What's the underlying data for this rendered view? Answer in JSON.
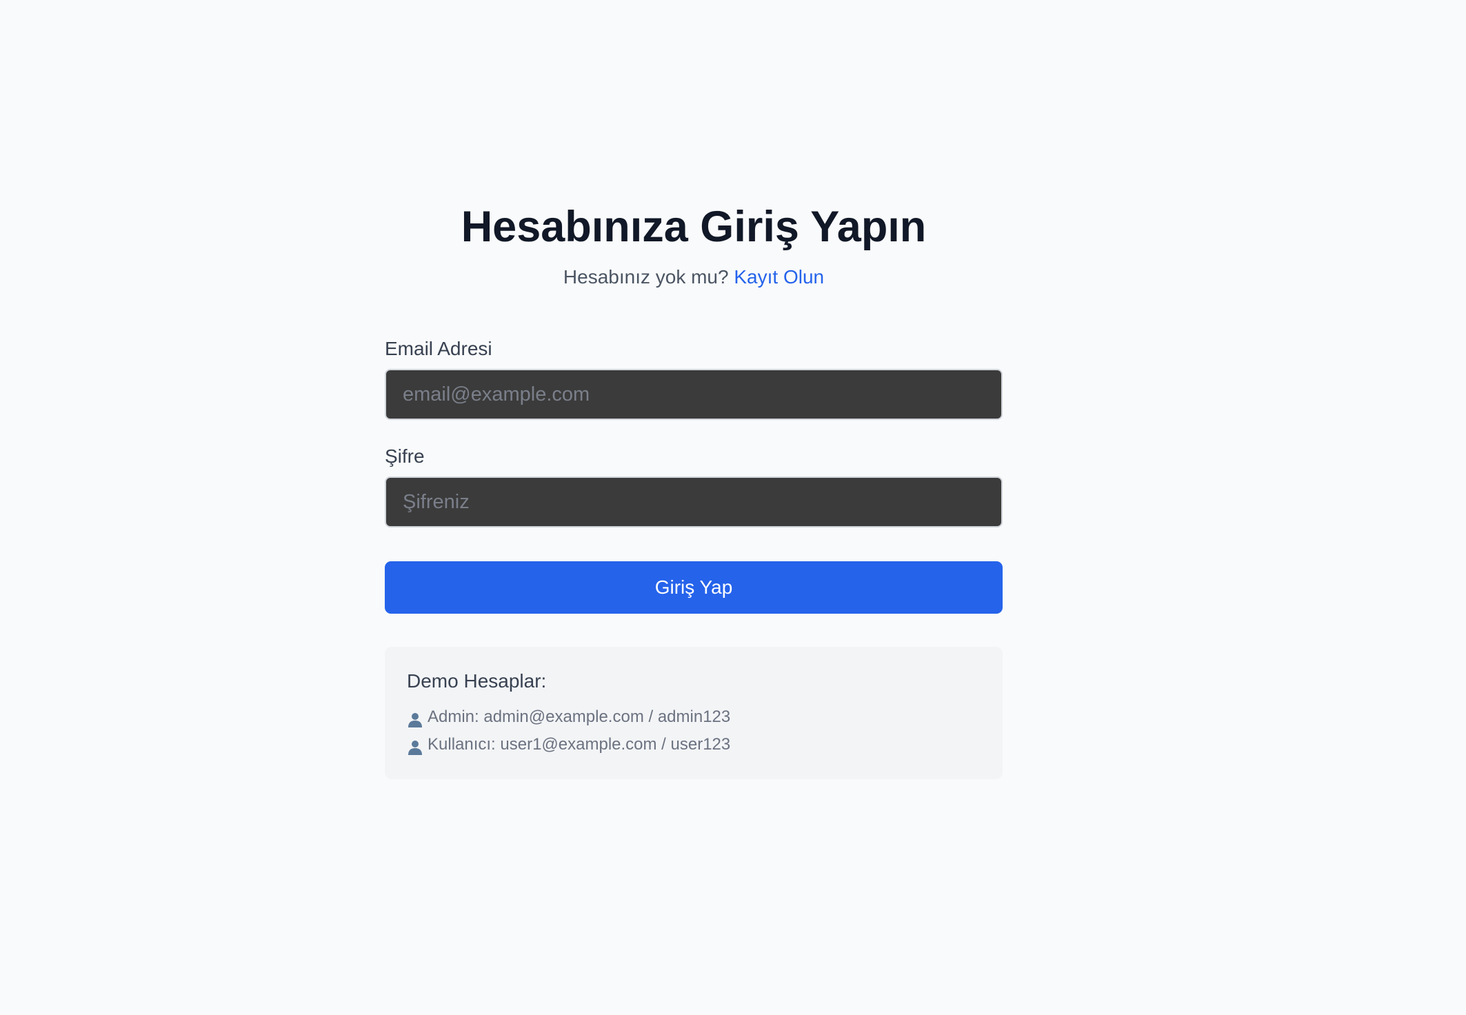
{
  "login": {
    "title": "Hesabınıza Giriş Yapın",
    "subtitle_text": "Hesabınız yok mu?",
    "register_link": "Kayıt Olun",
    "email_label": "Email Adresi",
    "email_placeholder": "email@example.com",
    "email_value": "",
    "password_label": "Şifre",
    "password_placeholder": "Şifreniz",
    "password_value": "",
    "submit_label": "Giriş Yap"
  },
  "demo": {
    "title": "Demo Hesaplar:",
    "accounts": [
      {
        "icon": "user-icon",
        "text": "Admin: admin@example.com / admin123"
      },
      {
        "icon": "user-icon",
        "text": "Kullanıcı: user1@example.com / user123"
      }
    ]
  },
  "colors": {
    "background": "#f9fafb",
    "primary": "#2563eb",
    "input_bg": "#3b3b3b",
    "demo_bg": "#f3f4f6"
  }
}
